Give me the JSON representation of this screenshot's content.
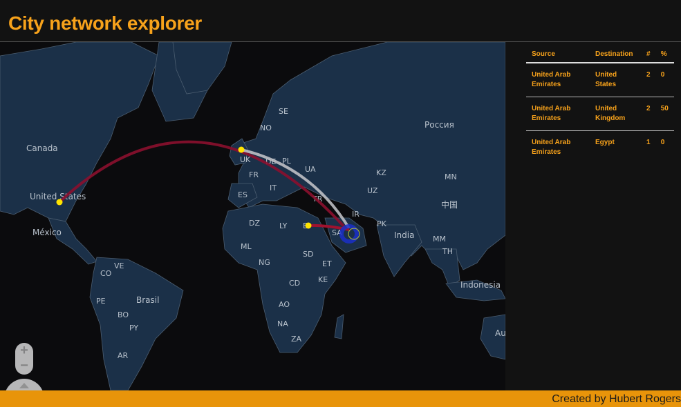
{
  "header": {
    "title": "City network explorer"
  },
  "map": {
    "country_labels": [
      {
        "text": "Canada",
        "cls": "lbl-big"
      },
      {
        "text": "United States",
        "cls": "lbl-big"
      },
      {
        "text": "México",
        "cls": "lbl-big"
      },
      {
        "text": "Brasil",
        "cls": "lbl-big"
      },
      {
        "text": "India",
        "cls": "lbl-big"
      },
      {
        "text": "Россия",
        "cls": "lbl-big"
      },
      {
        "text": "Indonesia",
        "cls": "lbl-big"
      },
      {
        "text": "中国",
        "cls": "lbl-big"
      },
      {
        "text": "Au",
        "cls": "lbl-big"
      },
      {
        "text": "SE"
      },
      {
        "text": "NO"
      },
      {
        "text": "UK"
      },
      {
        "text": "DE"
      },
      {
        "text": "PL"
      },
      {
        "text": "UA"
      },
      {
        "text": "FR"
      },
      {
        "text": "IT"
      },
      {
        "text": "ES"
      },
      {
        "text": "TR"
      },
      {
        "text": "KZ"
      },
      {
        "text": "MN"
      },
      {
        "text": "UZ"
      },
      {
        "text": "IR"
      },
      {
        "text": "PK"
      },
      {
        "text": "DZ"
      },
      {
        "text": "LY"
      },
      {
        "text": "E"
      },
      {
        "text": "SA"
      },
      {
        "text": "ML"
      },
      {
        "text": "NG"
      },
      {
        "text": "SD"
      },
      {
        "text": "ET"
      },
      {
        "text": "KE"
      },
      {
        "text": "CD"
      },
      {
        "text": "AO"
      },
      {
        "text": "NA"
      },
      {
        "text": "ZA"
      },
      {
        "text": "VE"
      },
      {
        "text": "CO"
      },
      {
        "text": "PE"
      },
      {
        "text": "BO"
      },
      {
        "text": "PY"
      },
      {
        "text": "AR"
      },
      {
        "text": "MM"
      },
      {
        "text": "TH"
      }
    ],
    "links": [
      {
        "source": "United Arab Emirates",
        "destination": "United States",
        "color": "#8b0f2e"
      },
      {
        "source": "United Arab Emirates",
        "destination": "United Kingdom",
        "color": "#c8c8cc"
      },
      {
        "source": "United Arab Emirates",
        "destination": "Egypt",
        "color": "#a0122f"
      }
    ],
    "colors": {
      "ocean": "#0b0b0d",
      "land": "#1b3048",
      "border": "#4b5d70",
      "city": "#ffe400",
      "hub": "#1a2fc9"
    },
    "controls": {
      "zoom_in": "+",
      "zoom_out": "−"
    }
  },
  "table": {
    "headers": [
      "Source",
      "Destination",
      "#",
      "%"
    ],
    "rows": [
      {
        "source": "United Arab Emirates",
        "destination": "United States",
        "count": "2",
        "percent": "0"
      },
      {
        "source": "United Arab Emirates",
        "destination": "United Kingdom",
        "count": "2",
        "percent": "50"
      },
      {
        "source": "United Arab Emirates",
        "destination": "Egypt",
        "count": "1",
        "percent": "0"
      }
    ]
  },
  "footer": {
    "credit": "Created by Hubert Rogers"
  }
}
